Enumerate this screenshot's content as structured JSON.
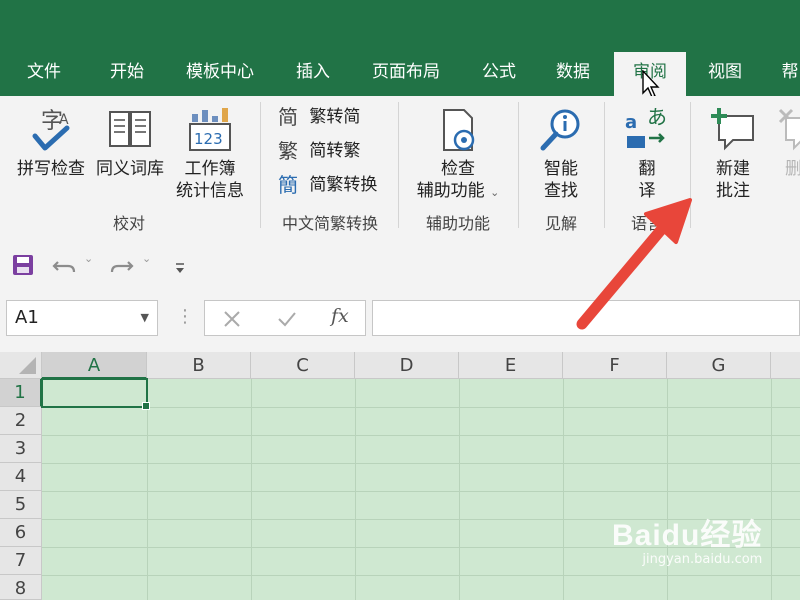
{
  "tabs": [
    {
      "label": "文件"
    },
    {
      "label": "开始"
    },
    {
      "label": "模板中心"
    },
    {
      "label": "插入"
    },
    {
      "label": "页面布局"
    },
    {
      "label": "公式"
    },
    {
      "label": "数据"
    },
    {
      "label": "审阅"
    },
    {
      "label": "视图"
    },
    {
      "label": "帮"
    }
  ],
  "active_tab": "审阅",
  "ribbon": {
    "proofing": {
      "spelling": "拼写检查",
      "thesaurus": "同义词库",
      "stats_line1": "工作簿",
      "stats_line2": "统计信息",
      "group_label": "校对"
    },
    "chinese_conversion": {
      "to_simplified": "繁转简",
      "to_traditional": "简转繁",
      "convert": "简繁转换",
      "group_label": "中文简繁转换"
    },
    "accessibility": {
      "check_line1": "检查",
      "check_line2": "辅助功能",
      "group_label": "辅助功能"
    },
    "insights": {
      "smart_line1": "智能",
      "smart_line2": "查找",
      "group_label": "见解"
    },
    "language": {
      "translate_line1": "翻",
      "translate_line2": "译",
      "group_label": "语言"
    },
    "comments": {
      "new_line1": "新建",
      "new_line2": "批注",
      "delete_label": "删除"
    }
  },
  "formula_bar": {
    "name_box": "A1",
    "formula": "",
    "fx_label": "fx"
  },
  "grid": {
    "columns": [
      "A",
      "B",
      "C",
      "D",
      "E",
      "F",
      "G"
    ],
    "rows": [
      "1",
      "2",
      "3",
      "4",
      "5",
      "6",
      "7",
      "8"
    ],
    "selected_cell": "A1"
  },
  "watermark": {
    "main": "Baidu经验",
    "sub": "jingyan.baidu.com"
  },
  "colors": {
    "brand": "#217346",
    "sheet_bg": "#cfe8d1",
    "arrow": "#e8463a"
  }
}
